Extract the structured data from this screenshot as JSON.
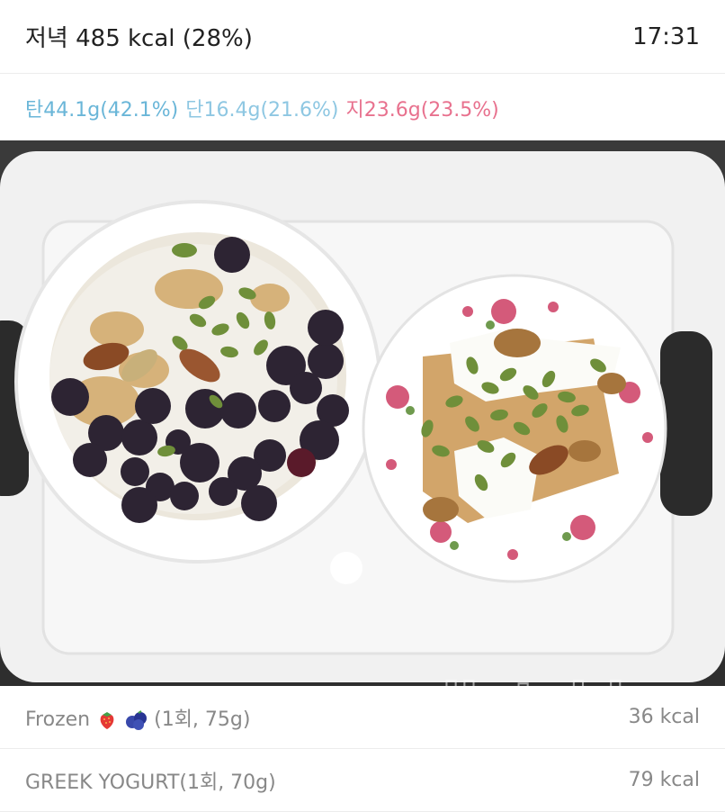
{
  "header": {
    "title": "저녁 485 kcal (28%)",
    "time": "17:31"
  },
  "macros": {
    "carb": "탄44.1g(42.1%)",
    "protein": "단16.4g(21.6%)",
    "fat": "지23.6g(23.5%)"
  },
  "colors": {
    "carb": "#6ab6d8",
    "protein": "#8ec7e2",
    "fat": "#e8718e"
  },
  "photo": {
    "watermark": "dietshin.com"
  },
  "items": [
    {
      "name_prefix": "Frozen ",
      "icons": [
        "strawberry-icon",
        "blueberries-icon"
      ],
      "name_suffix": "(1회, 75g)",
      "kcal": "36 kcal"
    },
    {
      "name": "GREEK YOGURT(1회, 70g)",
      "kcal": "79 kcal"
    }
  ]
}
